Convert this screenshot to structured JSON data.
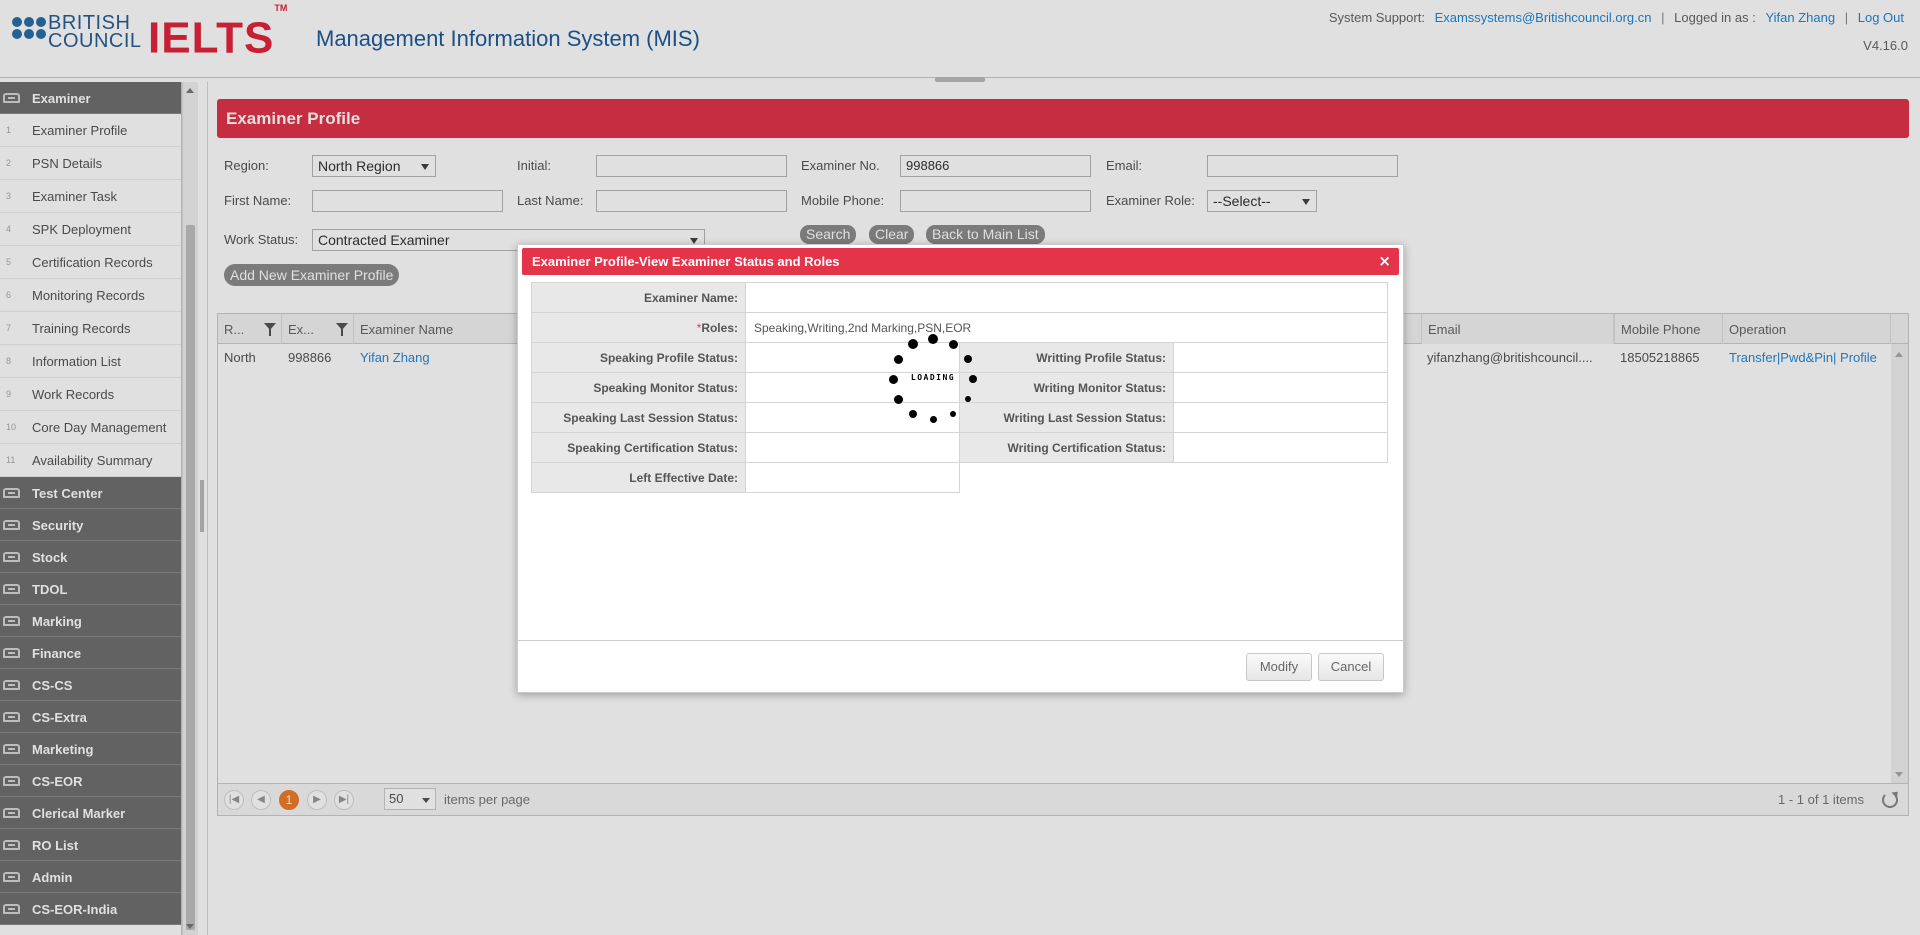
{
  "header": {
    "brand_line1": "BRITISH",
    "brand_line2": "COUNCIL",
    "ielts": "IELTS",
    "ielts_tm": "TM",
    "title": "Management Information System (MIS)",
    "support_label": "System Support:",
    "support_email": "Examssystems@Britishcouncil.org.cn",
    "logged_label": "Logged in as :",
    "user": "Yifan Zhang",
    "logout": "Log Out",
    "version": "V4.16.0"
  },
  "sidebar": {
    "groups_top": [
      {
        "label": "Examiner"
      }
    ],
    "sub_items": [
      {
        "num": "1",
        "label": "Examiner Profile"
      },
      {
        "num": "2",
        "label": "PSN Details"
      },
      {
        "num": "3",
        "label": "Examiner Task"
      },
      {
        "num": "4",
        "label": "SPK Deployment"
      },
      {
        "num": "5",
        "label": "Certification Records"
      },
      {
        "num": "6",
        "label": "Monitoring Records"
      },
      {
        "num": "7",
        "label": "Training Records"
      },
      {
        "num": "8",
        "label": "Information List"
      },
      {
        "num": "9",
        "label": "Work Records"
      },
      {
        "num": "10",
        "label": "Core Day Management"
      },
      {
        "num": "11",
        "label": "Availability Summary"
      }
    ],
    "groups": [
      {
        "label": "Test Center"
      },
      {
        "label": "Security"
      },
      {
        "label": "Stock"
      },
      {
        "label": "TDOL"
      },
      {
        "label": "Marking"
      },
      {
        "label": "Finance"
      },
      {
        "label": "CS-CS"
      },
      {
        "label": "CS-Extra"
      },
      {
        "label": "Marketing"
      },
      {
        "label": "CS-EOR"
      },
      {
        "label": "Clerical Marker"
      },
      {
        "label": "RO List"
      },
      {
        "label": "Admin"
      },
      {
        "label": "CS-EOR-India"
      }
    ]
  },
  "page": {
    "title": "Examiner Profile"
  },
  "filters": {
    "region_label": "Region:",
    "region_value": "North Region",
    "initial_label": "Initial:",
    "initial_value": "",
    "examiner_no_label": "Examiner No.",
    "examiner_no_value": "998866",
    "email_label": "Email:",
    "email_value": "",
    "first_name_label": "First Name:",
    "first_name_value": "",
    "last_name_label": "Last Name:",
    "last_name_value": "",
    "mobile_label": "Mobile Phone:",
    "mobile_value": "",
    "role_label": "Examiner Role:",
    "role_value": "--Select--",
    "work_status_label": "Work Status:",
    "work_status_value": "Contracted Examiner",
    "search": "Search",
    "clear": "Clear",
    "back": "Back to Main List",
    "add_new": "Add New Examiner Profile"
  },
  "grid": {
    "headers": {
      "region": "R...",
      "examiner_no": "Ex...",
      "name": "Examiner Name",
      "email": "Email",
      "mobile": "Mobile Phone",
      "operation": "Operation"
    },
    "rows": [
      {
        "region": "North",
        "examiner_no": "998866",
        "name": "Yifan Zhang",
        "email": "yifanzhang@britishcouncil....",
        "mobile": "18505218865",
        "operation": "Transfer|Pwd&Pin| Profile"
      }
    ],
    "pager": {
      "current_page": "1",
      "page_size": "50",
      "per_page_label": "items per page",
      "summary": "1 - 1 of 1 items"
    }
  },
  "dialog": {
    "title": "Examiner Profile-View Examiner Status and Roles",
    "close": "×",
    "labels": {
      "examiner_name": "Examiner Name:",
      "roles_req": "*",
      "roles": "Roles:",
      "speaking_profile": "Speaking Profile Status:",
      "writing_profile": "Writting Profile Status:",
      "speaking_monitor": "Speaking Monitor Status:",
      "writing_monitor": "Writing Monitor Status:",
      "speaking_last": "Speaking Last Session Status:",
      "writing_last": "Writing Last Session Status:",
      "speaking_cert": "Speaking Certification Status:",
      "writing_cert": "Writing Certification Status:",
      "left_date": "Left Effective Date:"
    },
    "values": {
      "examiner_name": "",
      "roles": "Speaking,Writing,2nd Marking,PSN,EOR",
      "speaking_profile": "",
      "writing_profile": "",
      "speaking_monitor": "",
      "writing_monitor": "",
      "speaking_last": "",
      "writing_last": "",
      "speaking_cert": "",
      "writing_cert": "",
      "left_date": ""
    },
    "modify": "Modify",
    "cancel": "Cancel"
  },
  "loading": {
    "text": "LOADING"
  },
  "colors": {
    "accent_red": "#e3344a",
    "link_blue": "#2788d4",
    "sidebar_group": "#707070",
    "pager_active": "#ef7d2e"
  }
}
